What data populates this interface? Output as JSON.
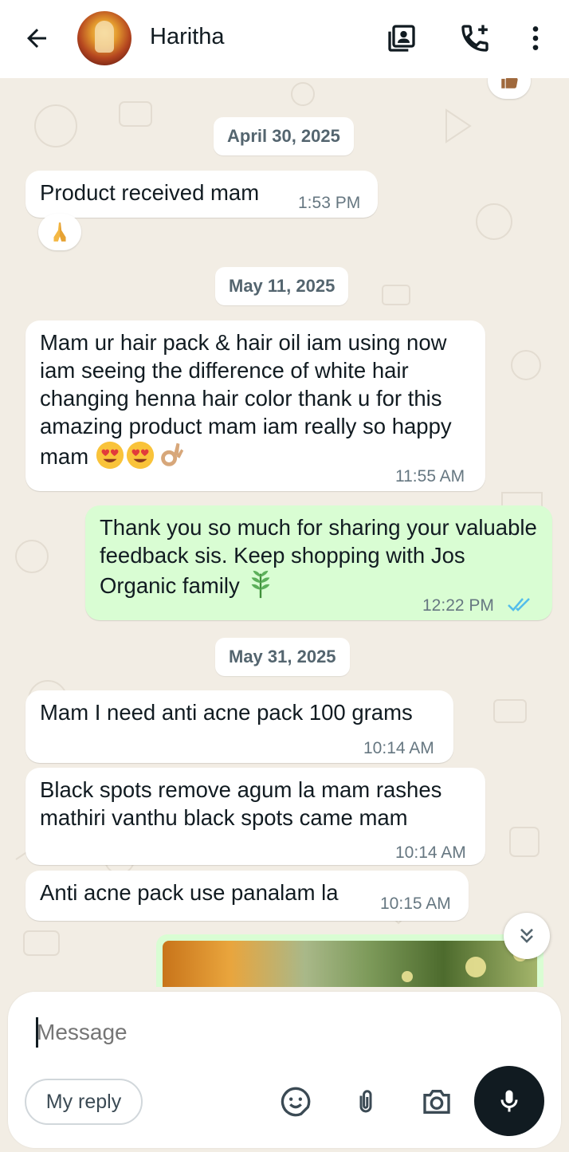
{
  "header": {
    "contact_name": "Haritha",
    "icons": [
      "back-arrow-icon",
      "avatar",
      "contact-card-icon",
      "add-call-icon",
      "more-options-icon"
    ]
  },
  "chat": {
    "dates": [
      "April 30, 2025",
      "May 11, 2025",
      "May 31, 2025"
    ],
    "messages": [
      {
        "direction": "in",
        "text": "Product received mam",
        "time": "1:53 PM",
        "reaction": "folded-hands-emoji"
      },
      {
        "direction": "in",
        "text": "Mam ur hair pack & hair oil iam using now iam seeing the difference of white hair changing henna hair color thank u for this amazing product mam iam really so happy mam",
        "emojis": [
          "heart-eyes-emoji",
          "heart-eyes-emoji",
          "ok-hand-emoji"
        ],
        "time": "11:55 AM"
      },
      {
        "direction": "out",
        "text": "Thank you so much for sharing your valuable feedback sis. Keep shopping with Jos Organic family",
        "emojis": [
          "herb-emoji"
        ],
        "time": "12:22 PM",
        "status": "read"
      },
      {
        "direction": "in",
        "text": "Mam I need anti acne pack 100 grams",
        "time": "10:14 AM"
      },
      {
        "direction": "in",
        "text": "Black spots remove agum la mam rashes mathiri vanthu black spots came mam",
        "time": "10:14 AM"
      },
      {
        "direction": "in",
        "text": "Anti acne pack use panalam la",
        "time": "10:15 AM"
      }
    ],
    "top_reaction": "thumbs-up-emoji",
    "image_message": "photo-thumbnail"
  },
  "composer": {
    "placeholder": "Message",
    "quick_reply": "My reply",
    "icons": [
      "sticker-icon",
      "attach-icon",
      "camera-icon",
      "mic-icon"
    ]
  },
  "colors": {
    "incoming_bubble": "#ffffff",
    "outgoing_bubble": "#d9fdd3",
    "background": "#f2ede4",
    "read_ticks": "#53bdeb",
    "timestamp": "#667781"
  }
}
